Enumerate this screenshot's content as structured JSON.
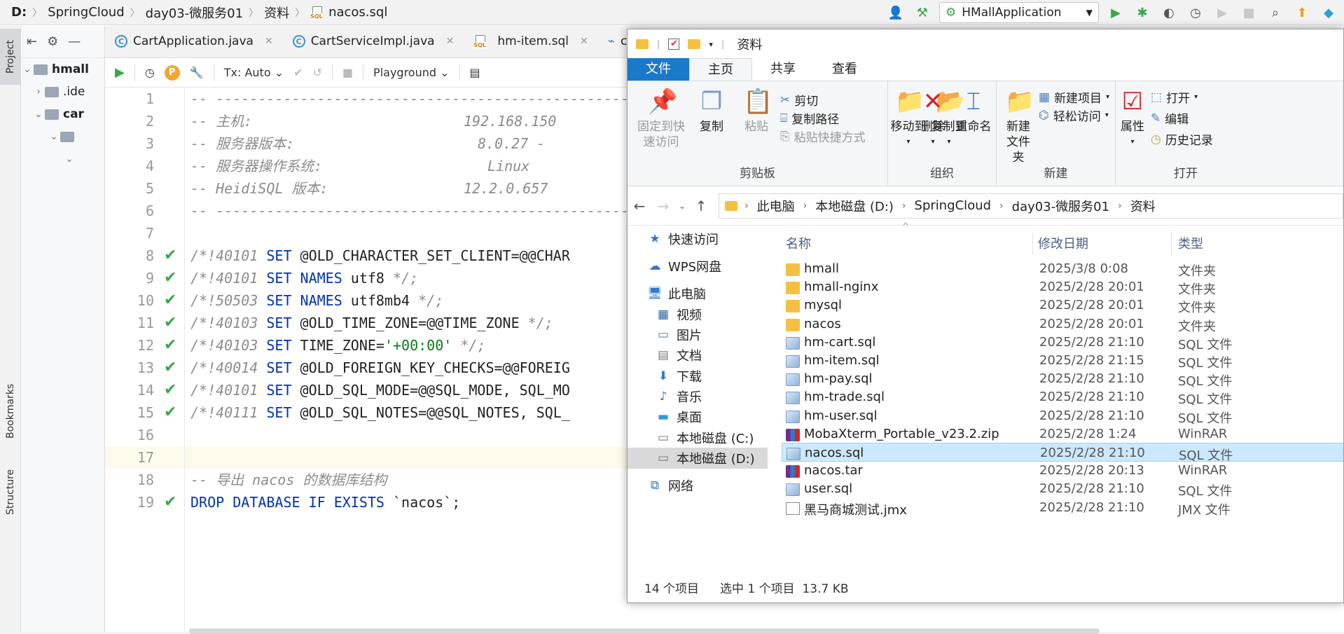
{
  "ide": {
    "breadcrumb": [
      "D:",
      "SpringCloud",
      "day03-微服务01",
      "资料",
      "nacos.sql"
    ],
    "run_config": "HMallApplication",
    "left_tabs": [
      "Project",
      "Bookmarks",
      "Structure"
    ],
    "project_tree": [
      "hmall",
      ".ide",
      "car"
    ],
    "tabs": [
      {
        "label": "CartApplication.java",
        "icon": "class-icon"
      },
      {
        "label": "CartServiceImpl.java",
        "icon": "class-icon"
      },
      {
        "label": "hm-item.sql",
        "icon": "sql-file-icon"
      },
      {
        "label": "cor",
        "icon": "config-icon"
      }
    ],
    "db_toolbar": {
      "tx_mode": "Tx: Auto",
      "playground": "Playground"
    },
    "line_numbers": [
      "1",
      "2",
      "3",
      "4",
      "5",
      "6",
      "7",
      "8",
      "9",
      "10",
      "11",
      "12",
      "13",
      "14",
      "15",
      "16",
      "17",
      "18",
      "19"
    ],
    "code": {
      "l1": "-- ------------------------------------------------------",
      "l2a": "-- 主机:",
      "l2b": "192.168.150",
      "l3a": "-- 服务器版本:",
      "l3b": "8.0.27 -",
      "l4a": "-- 服务器操作系统:",
      "l4b": "Linux",
      "l5a": "-- HeidiSQL 版本:",
      "l5b": "12.2.0.657",
      "l6": "-- ------------------------------------------------------",
      "c8": "/*!40101",
      "k8": "SET",
      "t8": "@OLD_CHARACTER_SET_CLIENT=@@CHAR",
      "c9": "/*!40101",
      "k9": "SET NAMES",
      "t9": "utf8",
      "e9": "*/;",
      "c10": "/*!50503",
      "k10": "SET NAMES",
      "t10": "utf8mb4",
      "e10": "*/;",
      "c11": "/*!40103",
      "k11": "SET",
      "t11": "@OLD_TIME_ZONE=@@TIME_ZONE",
      "e11": "*/;",
      "c12": "/*!40103",
      "k12": "SET",
      "t12": "TIME_ZONE=",
      "s12": "'+00:00'",
      "e12": "*/;",
      "c13": "/*!40014",
      "k13": "SET",
      "t13": "@OLD_FOREIGN_KEY_CHECKS=@@FOREIG",
      "c14": "/*!40101",
      "k14": "SET",
      "t14": "@OLD_SQL_MODE=@@SQL_MODE, SQL_MO",
      "c15": "/*!40111",
      "k15": "SET",
      "t15": "@OLD_SQL_NOTES=@@SQL_NOTES, SQL_",
      "l18": "-- 导出 nacos 的数据库结构",
      "k19": "DROP DATABASE IF EXISTS",
      "t19": "`nacos`;"
    }
  },
  "explorer": {
    "title": "资料",
    "ribbon_tabs": [
      "文件",
      "主页",
      "共享",
      "查看"
    ],
    "clipboard": {
      "pin": "固定到快\n速访问",
      "copy": "复制",
      "paste": "粘贴",
      "cut": "剪切",
      "copy_path": "复制路径",
      "paste_shortcut": "粘贴快捷方式",
      "label": "剪贴板"
    },
    "organize": {
      "move_to": "移动到",
      "copy_to": "复制到",
      "delete": "删除",
      "rename": "重命名",
      "label": "组织"
    },
    "new": {
      "new_folder": "新建\n文件夹",
      "new_item": "新建项目",
      "easy_access": "轻松访问",
      "label": "新建"
    },
    "open": {
      "properties": "属性",
      "open": "打开",
      "edit": "编辑",
      "history": "历史记录",
      "label": "打开"
    },
    "address": [
      "此电脑",
      "本地磁盘 (D:)",
      "SpringCloud",
      "day03-微服务01",
      "资料"
    ],
    "nav": [
      "快速访问",
      "WPS网盘",
      "此电脑",
      "视频",
      "图片",
      "文档",
      "下载",
      "音乐",
      "桌面",
      "本地磁盘 (C:)",
      "本地磁盘 (D:)",
      "网络"
    ],
    "columns": [
      "名称",
      "修改日期",
      "类型"
    ],
    "files": [
      {
        "name": "hmall",
        "date": "2025/3/8 0:08",
        "type": "文件夹",
        "icon": "folder"
      },
      {
        "name": "hmall-nginx",
        "date": "2025/2/28 20:01",
        "type": "文件夹",
        "icon": "folder"
      },
      {
        "name": "mysql",
        "date": "2025/2/28 20:01",
        "type": "文件夹",
        "icon": "folder"
      },
      {
        "name": "nacos",
        "date": "2025/2/28 20:01",
        "type": "文件夹",
        "icon": "folder"
      },
      {
        "name": "hm-cart.sql",
        "date": "2025/2/28 21:10",
        "type": "SQL 文件",
        "icon": "sql"
      },
      {
        "name": "hm-item.sql",
        "date": "2025/2/28 21:15",
        "type": "SQL 文件",
        "icon": "sql"
      },
      {
        "name": "hm-pay.sql",
        "date": "2025/2/28 21:10",
        "type": "SQL 文件",
        "icon": "sql"
      },
      {
        "name": "hm-trade.sql",
        "date": "2025/2/28 21:10",
        "type": "SQL 文件",
        "icon": "sql"
      },
      {
        "name": "hm-user.sql",
        "date": "2025/2/28 21:10",
        "type": "SQL 文件",
        "icon": "sql"
      },
      {
        "name": "MobaXterm_Portable_v23.2.zip",
        "date": "2025/2/28 1:24",
        "type": "WinRAR",
        "icon": "rar"
      },
      {
        "name": "nacos.sql",
        "date": "2025/2/28 21:10",
        "type": "SQL 文件",
        "icon": "sql"
      },
      {
        "name": "nacos.tar",
        "date": "2025/2/28 20:13",
        "type": "WinRAR",
        "icon": "rar"
      },
      {
        "name": "user.sql",
        "date": "2025/2/28 21:10",
        "type": "SQL 文件",
        "icon": "sql"
      },
      {
        "name": "黑马商城测试.jmx",
        "date": "2025/2/28 21:10",
        "type": "JMX 文件",
        "icon": "doc"
      }
    ],
    "selected_file": "nacos.sql",
    "status": {
      "count": "14 个项目",
      "selection": "选中 1 个项目  13.7 KB"
    }
  }
}
